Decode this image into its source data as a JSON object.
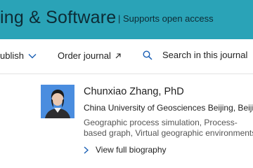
{
  "header": {
    "journal_title": "ing & Software",
    "open_access_badge": "| Supports open access"
  },
  "nav": {
    "publish_label": "ublish",
    "order_label": "Order journal",
    "search_placeholder": "Search in this journal"
  },
  "editor": {
    "name": "Chunxiao Zhang, PhD",
    "affiliation": "China University of Geosciences Beijing, Beijing,",
    "interests": "Geographic process simulation, Process-based graph, Virtual geographic environments",
    "bio_link": "View full biography"
  },
  "colors": {
    "banner": "#2aa3b7",
    "link_blue": "#1a5fb4",
    "text": "#1f1f1f",
    "muted": "#555555"
  },
  "icons": {
    "publish_dropdown": "chevron-down-icon",
    "order_external": "arrow-up-right-icon",
    "search": "search-icon",
    "bio_link": "chevron-right-icon"
  }
}
